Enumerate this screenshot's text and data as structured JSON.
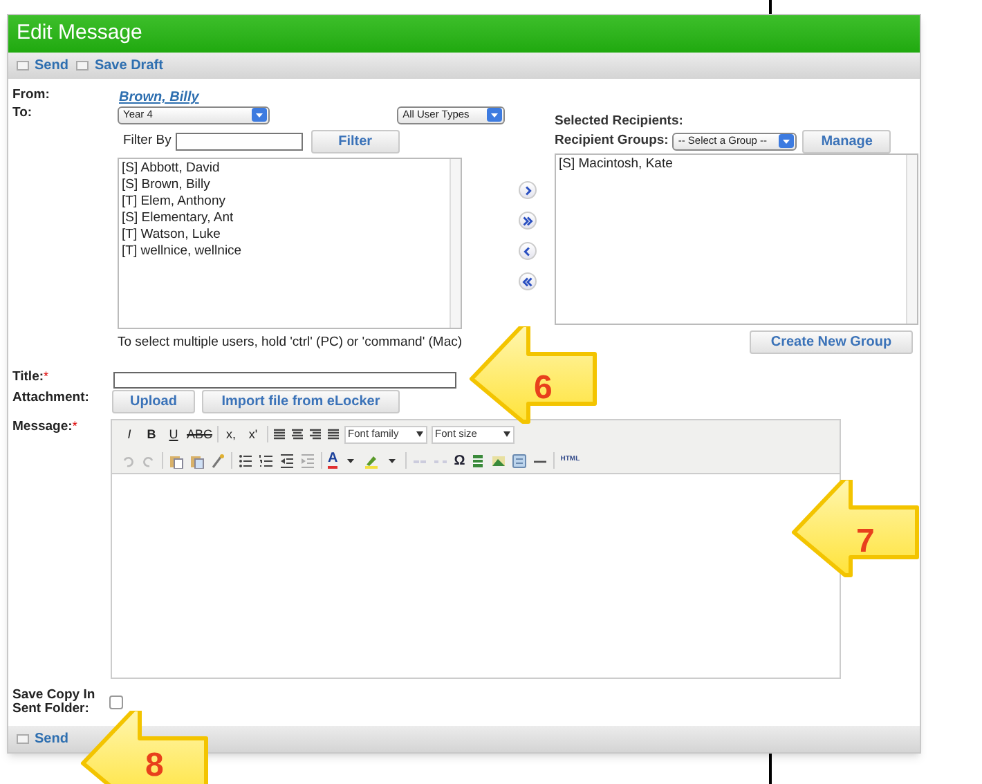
{
  "window": {
    "title": "Edit Message"
  },
  "toolbar": [
    {
      "label": "Send"
    },
    {
      "label": "Save Draft"
    }
  ],
  "from": {
    "label": "From:",
    "value": "Brown, Billy"
  },
  "to": {
    "label": "To:",
    "class_select": "Year 4",
    "type_select": "All User Types",
    "filter_label": "Filter By",
    "filter_button": "Filter",
    "users": [
      {
        "name": "[S] Abbott, David",
        "selected": false
      },
      {
        "name": "[S] Brown, Billy",
        "selected": false
      },
      {
        "name": "[T] Elem, Anthony",
        "selected": false
      },
      {
        "name": "[S] Elementary, Ant",
        "selected": false
      },
      {
        "name": "[T] Watson, Luke",
        "selected": false
      },
      {
        "name": "[T] wellnice, wellnice",
        "selected": false
      }
    ],
    "hint": "To select multiple users, hold 'ctrl' (PC) or 'command' (Mac)"
  },
  "recipients": {
    "heading": "Selected Recipients:",
    "groups_label": "Recipient Groups:",
    "group_select": "-- Select a Group --",
    "manage_button": "Manage",
    "selected": [
      {
        "name": "[S] Macintosh, Kate",
        "selected": false
      }
    ],
    "create_button": "Create New Group"
  },
  "title_field": {
    "label": "Title:",
    "required_mark": "*"
  },
  "attachment": {
    "label": "Attachment:",
    "buttons": [
      "Upload",
      "Import file from eLocker"
    ]
  },
  "message": {
    "label": "Message:",
    "required_mark": "*",
    "format_buttons": [
      "I",
      "B",
      "U",
      "ABC",
      "x,",
      "x'"
    ],
    "font_family": "Font family",
    "font_size": "Font size",
    "font_color": "A",
    "symbol": "Ω",
    "code_label": "HTML"
  },
  "save_copy": {
    "label": "Save Copy In Sent Folder:",
    "checked": false
  },
  "footer": {
    "send": "Send"
  },
  "callouts": [
    {
      "number": "6"
    },
    {
      "number": "7"
    },
    {
      "number": "8"
    }
  ]
}
